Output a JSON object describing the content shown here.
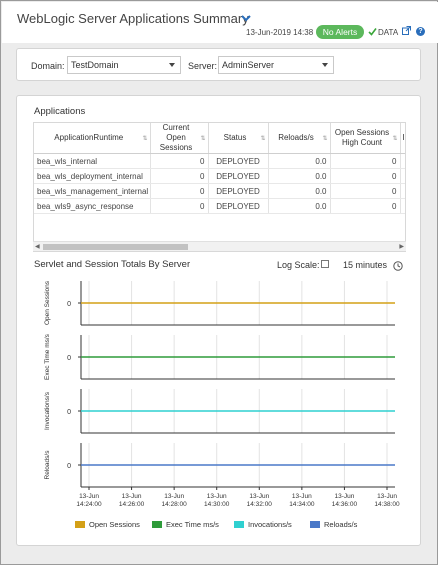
{
  "header": {
    "title": "WebLogic Server Applications Summary",
    "timestamp": "13-Jun-2019 14:38",
    "alert_badge": "No Alerts",
    "data_label": "DATA",
    "help": "?"
  },
  "filters": {
    "domain_label": "Domain:",
    "domain_value": "TestDomain",
    "server_label": "Server:",
    "server_value": "AdminServer"
  },
  "applications": {
    "title": "Applications",
    "columns": [
      "ApplicationRuntime",
      "Current Open Sessions",
      "Status",
      "Reloads/s",
      "Open Sessions High Count",
      "I"
    ],
    "rows": [
      [
        "bea_wls_internal",
        "0",
        "DEPLOYED",
        "0.0",
        "0"
      ],
      [
        "bea_wls_deployment_internal",
        "0",
        "DEPLOYED",
        "0.0",
        "0"
      ],
      [
        "bea_wls_management_internal",
        "0",
        "DEPLOYED",
        "0.0",
        "0"
      ],
      [
        "bea_wls9_async_response",
        "0",
        "DEPLOYED",
        "0.0",
        "0"
      ]
    ]
  },
  "totals": {
    "title": "Servlet and Session Totals By Server",
    "log_scale_label": "Log Scale:",
    "log_scale_checked": false,
    "time_range": "15 minutes"
  },
  "chart_data": {
    "type": "line",
    "x": [
      "13-Jun 14:24:00",
      "13-Jun 14:26:00",
      "13-Jun 14:28:00",
      "13-Jun 14:30:00",
      "13-Jun 14:32:00",
      "13-Jun 14:34:00",
      "13-Jun 14:36:00",
      "13-Jun 14:38:00"
    ],
    "x_tick_date": "13-Jun",
    "x_tick_times": [
      "14:24:00",
      "14:26:00",
      "14:28:00",
      "14:30:00",
      "14:32:00",
      "14:34:00",
      "14:36:00",
      "14:38:00"
    ],
    "grid": true,
    "legend_position": "bottom",
    "series": [
      {
        "name": "Open Sessions",
        "ylabel": "Open Sessions",
        "color": "#d4a017",
        "ytick": "0",
        "values": [
          0,
          0,
          0,
          0,
          0,
          0,
          0,
          0
        ]
      },
      {
        "name": "Exec Time ms/s",
        "ylabel": "Exec Time ms/s",
        "color": "#2e9b3a",
        "ytick": "0",
        "values": [
          0,
          0,
          0,
          0,
          0,
          0,
          0,
          0
        ]
      },
      {
        "name": "Invocations/s",
        "ylabel": "Invocations/s",
        "color": "#2fd0d0",
        "ytick": "0",
        "values": [
          0,
          0,
          0,
          0,
          0,
          0,
          0,
          0
        ]
      },
      {
        "name": "Reloads/s",
        "ylabel": "Reloads/s",
        "color": "#4a78c8",
        "ytick": "0",
        "values": [
          0,
          0,
          0,
          0,
          0,
          0,
          0,
          0
        ]
      }
    ]
  }
}
